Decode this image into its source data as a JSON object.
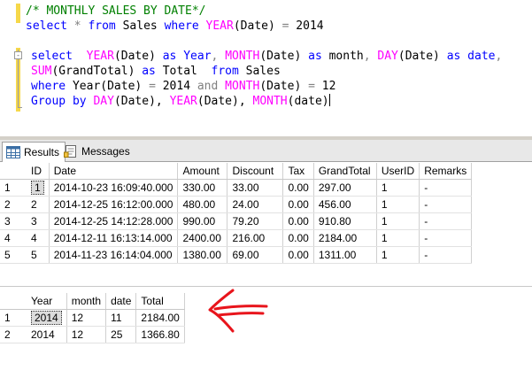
{
  "editor": {
    "line1": "/* MONTHLY SALES BY DATE*/",
    "line2": [
      {
        "t": "select",
        "c": "kw"
      },
      {
        "t": " ",
        "c": "plain"
      },
      {
        "t": "*",
        "c": "op"
      },
      {
        "t": " ",
        "c": "plain"
      },
      {
        "t": "from",
        "c": "kw"
      },
      {
        "t": " Sales ",
        "c": "plain"
      },
      {
        "t": "where",
        "c": "kw"
      },
      {
        "t": " ",
        "c": "plain"
      },
      {
        "t": "YEAR",
        "c": "fn"
      },
      {
        "t": "(Date) ",
        "c": "plain"
      },
      {
        "t": "=",
        "c": "op"
      },
      {
        "t": " 2014",
        "c": "plain"
      }
    ],
    "line4": [
      {
        "t": "select",
        "c": "kw"
      },
      {
        "t": "  ",
        "c": "plain"
      },
      {
        "t": "YEAR",
        "c": "fn"
      },
      {
        "t": "(Date) ",
        "c": "plain"
      },
      {
        "t": "as",
        "c": "kw"
      },
      {
        "t": " ",
        "c": "plain"
      },
      {
        "t": "Year",
        "c": "kw"
      },
      {
        "t": ", ",
        "c": "op"
      },
      {
        "t": "MONTH",
        "c": "fn"
      },
      {
        "t": "(Date) ",
        "c": "plain"
      },
      {
        "t": "as",
        "c": "kw"
      },
      {
        "t": " month",
        "c": "plain"
      },
      {
        "t": ", ",
        "c": "op"
      },
      {
        "t": "DAY",
        "c": "fn"
      },
      {
        "t": "(Date) ",
        "c": "plain"
      },
      {
        "t": "as",
        "c": "kw"
      },
      {
        "t": " ",
        "c": "plain"
      },
      {
        "t": "date",
        "c": "kw"
      },
      {
        "t": ",",
        "c": "op"
      }
    ],
    "line5": [
      {
        "t": "SUM",
        "c": "fn"
      },
      {
        "t": "(GrandTotal) ",
        "c": "plain"
      },
      {
        "t": "as",
        "c": "kw"
      },
      {
        "t": " Total  ",
        "c": "plain"
      },
      {
        "t": "from",
        "c": "kw"
      },
      {
        "t": " Sales",
        "c": "plain"
      }
    ],
    "line6": [
      {
        "t": "where",
        "c": "kw"
      },
      {
        "t": " Year(Date) ",
        "c": "plain"
      },
      {
        "t": "=",
        "c": "op"
      },
      {
        "t": " 2014 ",
        "c": "plain"
      },
      {
        "t": "and",
        "c": "op"
      },
      {
        "t": " ",
        "c": "plain"
      },
      {
        "t": "MONTH",
        "c": "fn"
      },
      {
        "t": "(Date) ",
        "c": "plain"
      },
      {
        "t": "=",
        "c": "op"
      },
      {
        "t": " 12",
        "c": "plain"
      }
    ],
    "line7": [
      {
        "t": "Group",
        "c": "kw"
      },
      {
        "t": " ",
        "c": "plain"
      },
      {
        "t": "by",
        "c": "kw"
      },
      {
        "t": " ",
        "c": "plain"
      },
      {
        "t": "DAY",
        "c": "fn"
      },
      {
        "t": "(Date), ",
        "c": "plain"
      },
      {
        "t": "YEAR",
        "c": "fn"
      },
      {
        "t": "(Date), ",
        "c": "plain"
      },
      {
        "t": "MONTH",
        "c": "fn"
      },
      {
        "t": "(date)",
        "c": "plain"
      }
    ],
    "fold_glyph": "-",
    "colors": {
      "kw": "#0000ff",
      "fn": "#ff00ff",
      "op": "#808080",
      "plain": "#000000",
      "comment": "#008000"
    }
  },
  "tabs": [
    {
      "label": "Results",
      "icon": "results-grid-icon",
      "active": true
    },
    {
      "label": "Messages",
      "icon": "messages-icon",
      "active": false
    }
  ],
  "grid1": {
    "columns": [
      "",
      "ID",
      "Date",
      "Amount",
      "Discount",
      "Tax",
      "GrandTotal",
      "UserID",
      "Remarks"
    ],
    "rows": [
      [
        "1",
        "1",
        "2014-10-23 16:09:40.000",
        "330.00",
        "33.00",
        "0.00",
        "297.00",
        "1",
        "-"
      ],
      [
        "2",
        "2",
        "2014-12-25 16:12:00.000",
        "480.00",
        "24.00",
        "0.00",
        "456.00",
        "1",
        "-"
      ],
      [
        "3",
        "3",
        "2014-12-25 14:12:28.000",
        "990.00",
        "79.20",
        "0.00",
        "910.80",
        "1",
        "-"
      ],
      [
        "4",
        "4",
        "2014-12-11 16:13:14.000",
        "2400.00",
        "216.00",
        "0.00",
        "2184.00",
        "1",
        "-"
      ],
      [
        "5",
        "5",
        "2014-11-23 16:14:04.000",
        "1380.00",
        "69.00",
        "0.00",
        "1311.00",
        "1",
        "-"
      ]
    ]
  },
  "grid2": {
    "columns": [
      "",
      "Year",
      "month",
      "date",
      "Total"
    ],
    "rows": [
      [
        "1",
        "2014",
        "12",
        "11",
        "2184.00"
      ],
      [
        "2",
        "2014",
        "12",
        "25",
        "1366.80"
      ]
    ]
  },
  "annotation": {
    "arrow": "red-hand-drawn-arrow",
    "color": "#e8141b"
  }
}
